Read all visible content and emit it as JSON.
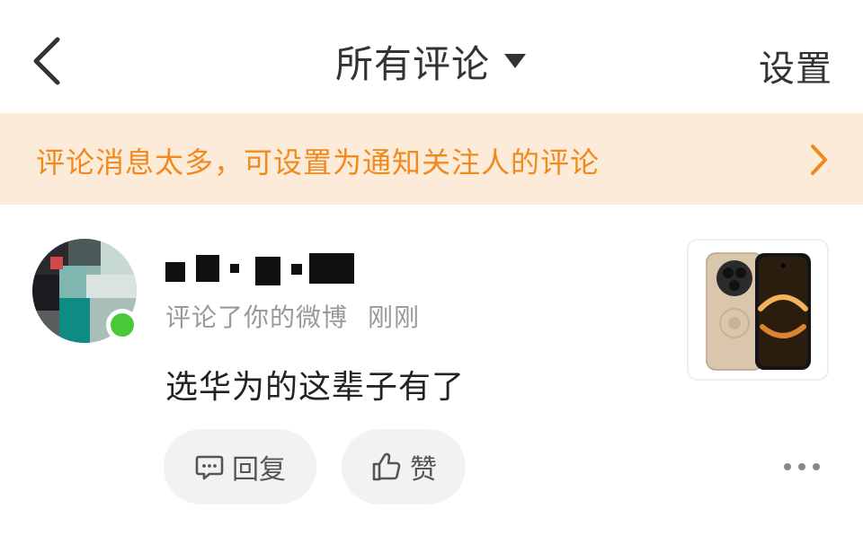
{
  "header": {
    "title": "所有评论",
    "settings_label": "设置",
    "back_icon": "chevron-left-icon",
    "dropdown_icon": "caret-down-icon"
  },
  "banner": {
    "text": "评论消息太多，可设置为通知关注人的评论",
    "color": "#f08a1f",
    "background": "#fdebd9",
    "arrow_icon": "chevron-right-icon"
  },
  "comment": {
    "action": "评论了你的微博",
    "time": "刚刚",
    "content": "选华为的这辈子有了",
    "reply_label": "回复",
    "like_label": "赞",
    "online_color": "#48c83a"
  }
}
